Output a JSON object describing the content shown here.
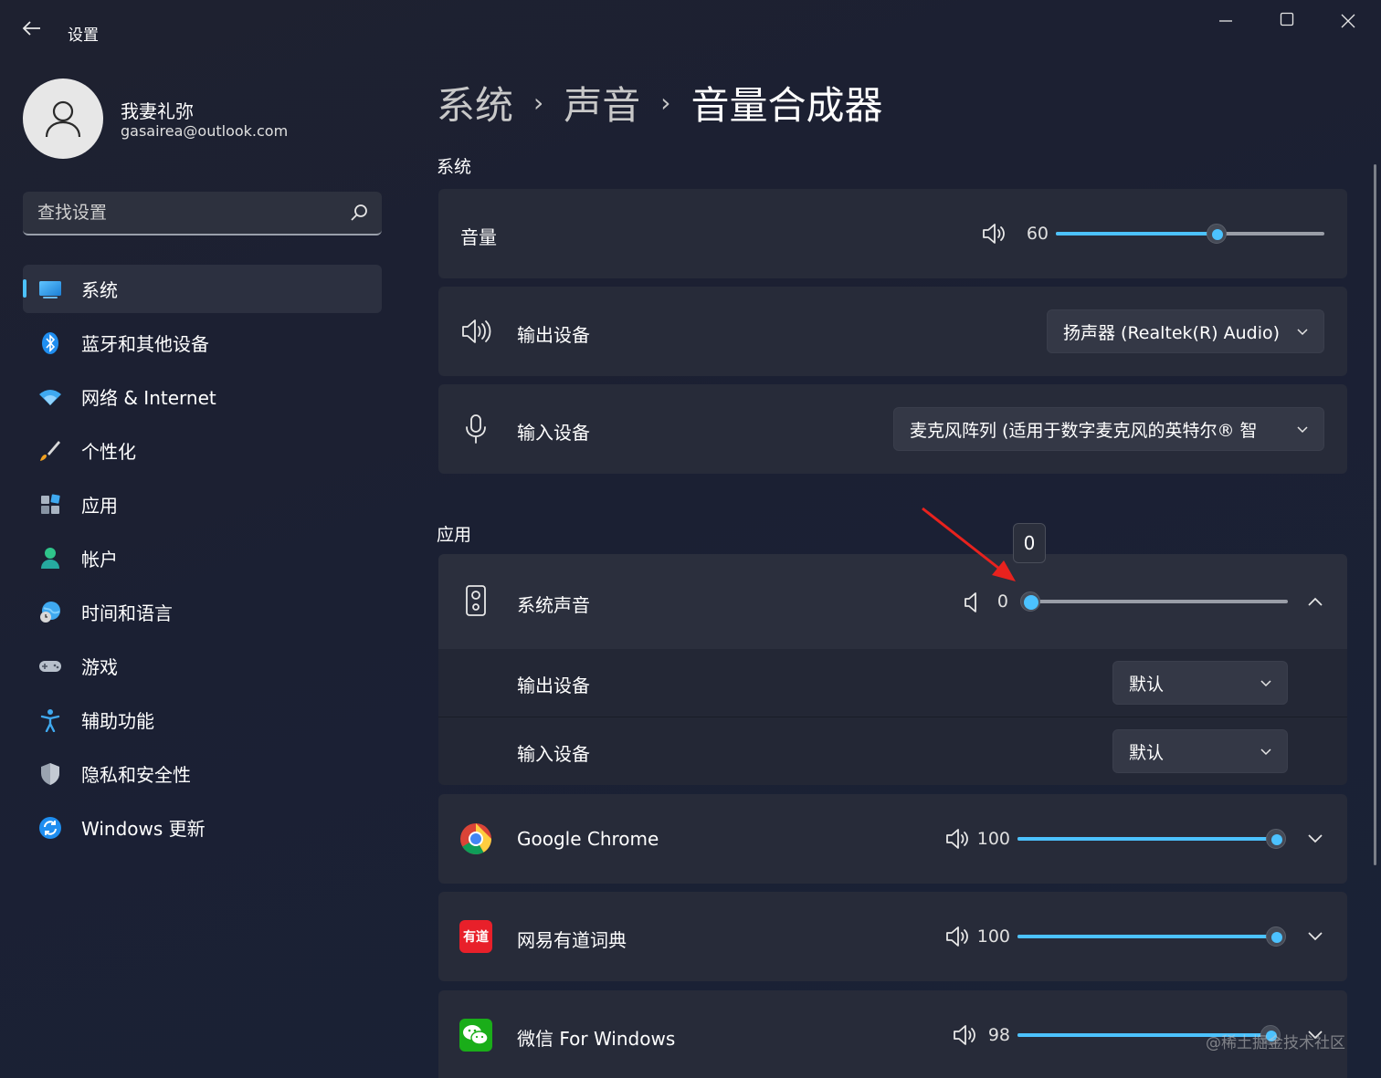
{
  "window": {
    "title": "设置",
    "controls": {
      "minimize": "—",
      "maximize": "☐",
      "close": "✕"
    }
  },
  "profile": {
    "name": "我妻礼弥",
    "email": "gasairea@outlook.com"
  },
  "search": {
    "placeholder": "查找设置"
  },
  "nav": {
    "items": [
      {
        "label": "系统",
        "icon": "monitor-icon",
        "active": true
      },
      {
        "label": "蓝牙和其他设备",
        "icon": "bluetooth-icon"
      },
      {
        "label": "网络 & Internet",
        "icon": "wifi-icon"
      },
      {
        "label": "个性化",
        "icon": "brush-icon"
      },
      {
        "label": "应用",
        "icon": "apps-icon"
      },
      {
        "label": "帐户",
        "icon": "account-icon"
      },
      {
        "label": "时间和语言",
        "icon": "globe-clock-icon"
      },
      {
        "label": "游戏",
        "icon": "gamepad-icon"
      },
      {
        "label": "辅助功能",
        "icon": "accessibility-icon"
      },
      {
        "label": "隐私和安全性",
        "icon": "shield-icon"
      },
      {
        "label": "Windows 更新",
        "icon": "update-icon"
      }
    ]
  },
  "breadcrumb": {
    "part1": "系统",
    "part2": "声音",
    "current": "音量合成器",
    "sep": "›"
  },
  "system_section": {
    "title": "系统",
    "volume": {
      "label": "音量",
      "value": "60",
      "level": 0.6
    },
    "output": {
      "label": "输出设备",
      "selected": "扬声器 (Realtek(R) Audio)"
    },
    "input": {
      "label": "输入设备",
      "selected": "麦克风阵列 (适用于数字麦克风的英特尔® 智"
    }
  },
  "apps_section": {
    "title": "应用",
    "tooltip": "0",
    "system_sounds": {
      "label": "系统声音",
      "value": "0",
      "level": 0,
      "output": {
        "label": "输出设备",
        "selected": "默认"
      },
      "input": {
        "label": "输入设备",
        "selected": "默认"
      }
    },
    "apps": [
      {
        "label": "Google Chrome",
        "value": "100",
        "level": 1.0,
        "icon": "chrome-icon"
      },
      {
        "label": "网易有道词典",
        "value": "100",
        "level": 1.0,
        "icon": "youdao-icon",
        "logo_text": "有道"
      },
      {
        "label": "微信 For Windows",
        "value": "98",
        "level": 0.98,
        "icon": "wechat-icon"
      }
    ]
  },
  "watermark": "@稀土掘金技术社区",
  "colors": {
    "accent": "#4cc2ff",
    "background": "#1e2130",
    "card": "#272b39",
    "arrow": "#e8221e"
  }
}
